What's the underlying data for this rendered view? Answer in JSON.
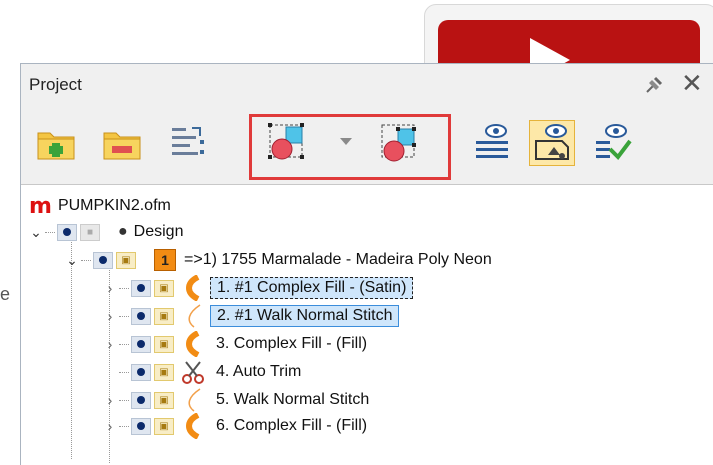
{
  "stray_char": "e",
  "panel": {
    "title": "Project",
    "colors": {
      "accent": "#e03a3a",
      "selection": "#cfe6fb",
      "thread": "#f28c14"
    }
  },
  "toolbar": {
    "buttons": [
      {
        "icon": "add-folder-icon"
      },
      {
        "icon": "remove-folder-icon"
      },
      {
        "icon": "sort-list-icon"
      },
      {
        "icon": "select-objects-icon"
      },
      {
        "icon": "select-objects-alt-icon"
      },
      {
        "icon": "view-list-icon"
      },
      {
        "icon": "view-shapes-icon",
        "active": true
      },
      {
        "icon": "view-check-icon"
      }
    ]
  },
  "tree": {
    "file": "PUMPKIN2.ofm",
    "design": "Design",
    "color_group": {
      "number": "1",
      "label": "=>1) 1755 Marmalade - Madeira Poly Neon"
    },
    "items": [
      {
        "label": "1. #1 Complex Fill - (Satin)",
        "state": "focused"
      },
      {
        "label": "2. #1 Walk Normal Stitch",
        "state": "selected"
      },
      {
        "label": "3. Complex Fill - (Fill)",
        "state": "normal"
      },
      {
        "label": "4. Auto Trim",
        "state": "normal"
      },
      {
        "label": "5. Walk Normal Stitch",
        "state": "normal"
      },
      {
        "label": "6. Complex Fill - (Fill)",
        "state": "normal"
      }
    ]
  }
}
